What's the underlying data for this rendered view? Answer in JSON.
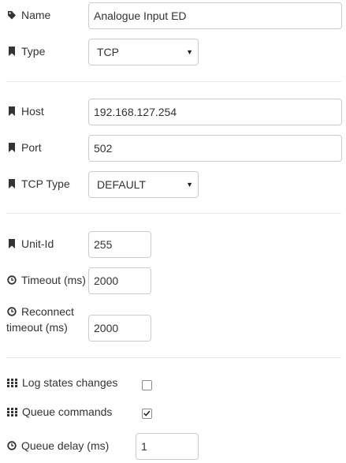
{
  "fields": {
    "name": {
      "label": "Name",
      "value": "Analogue Input ED",
      "icon": "tag-icon"
    },
    "type": {
      "label": "Type",
      "value": "TCP",
      "icon": "bookmark-icon"
    },
    "host": {
      "label": "Host",
      "value": "192.168.127.254",
      "icon": "bookmark-icon"
    },
    "port": {
      "label": "Port",
      "value": "502",
      "icon": "bookmark-icon"
    },
    "tcp_type": {
      "label": "TCP Type",
      "value": "DEFAULT",
      "icon": "bookmark-icon"
    },
    "unit_id": {
      "label": "Unit-Id",
      "value": "255",
      "icon": "bookmark-icon"
    },
    "timeout": {
      "label": "Timeout (ms)",
      "value": "2000",
      "icon": "clock-icon"
    },
    "reconnect_timeout": {
      "label_line1": "Reconnect",
      "label_line2": "timeout (ms)",
      "value": "2000",
      "icon": "clock-icon"
    },
    "log_states": {
      "label": "Log states changes",
      "checked": false,
      "icon": "grid-icon"
    },
    "queue_commands": {
      "label": "Queue commands",
      "checked": true,
      "icon": "grid-icon"
    },
    "queue_delay": {
      "label": "Queue delay (ms)",
      "value": "1",
      "icon": "clock-icon"
    }
  }
}
